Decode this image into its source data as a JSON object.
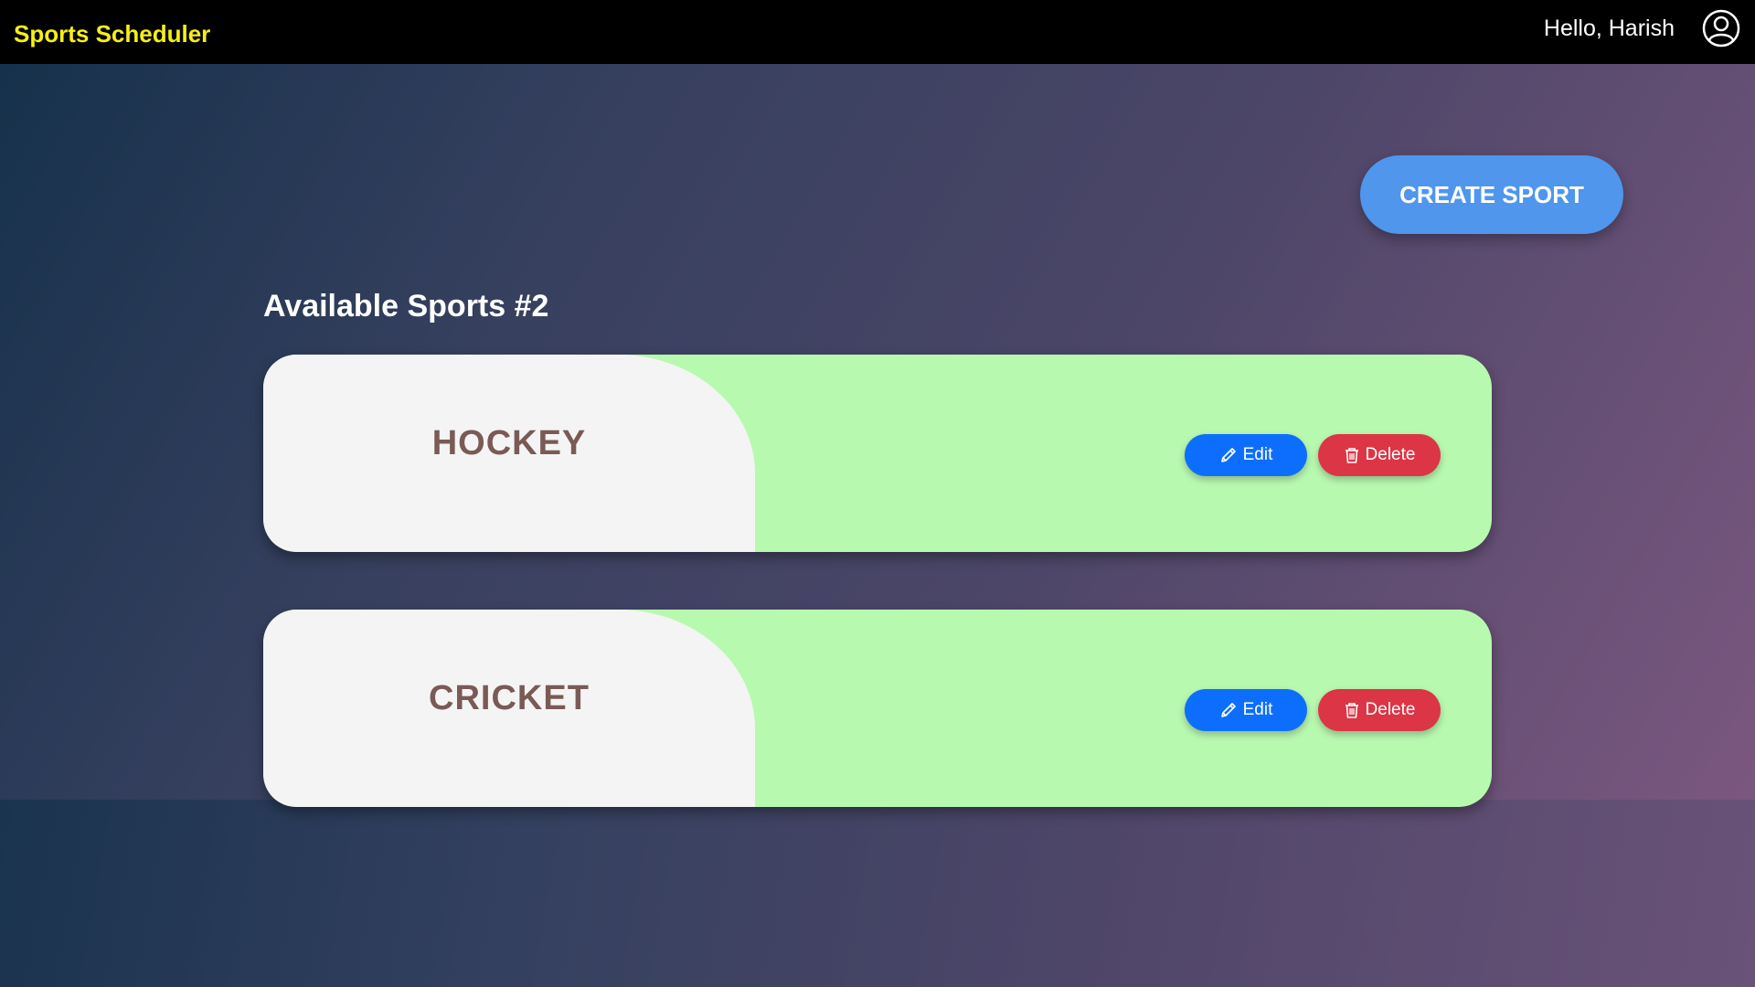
{
  "navbar": {
    "brand": "Sports Scheduler",
    "greeting": "Hello, Harish",
    "avatar_icon": "user-circle-icon"
  },
  "actions": {
    "create_label": "CREATE SPORT"
  },
  "section": {
    "title": "Available Sports #2"
  },
  "sports": [
    {
      "name": "HOCKEY",
      "edit_label": "Edit",
      "delete_label": "Delete"
    },
    {
      "name": "CRICKET",
      "edit_label": "Edit",
      "delete_label": "Delete"
    }
  ],
  "colors": {
    "brand": "#f5ef16",
    "create_button": "#4f96ec",
    "card_background": "#b8f9b0",
    "card_name_area": "#f4f4f4",
    "card_name_text": "#7a5a55",
    "edit_button": "#0d6efd",
    "delete_button": "#dc3545"
  }
}
